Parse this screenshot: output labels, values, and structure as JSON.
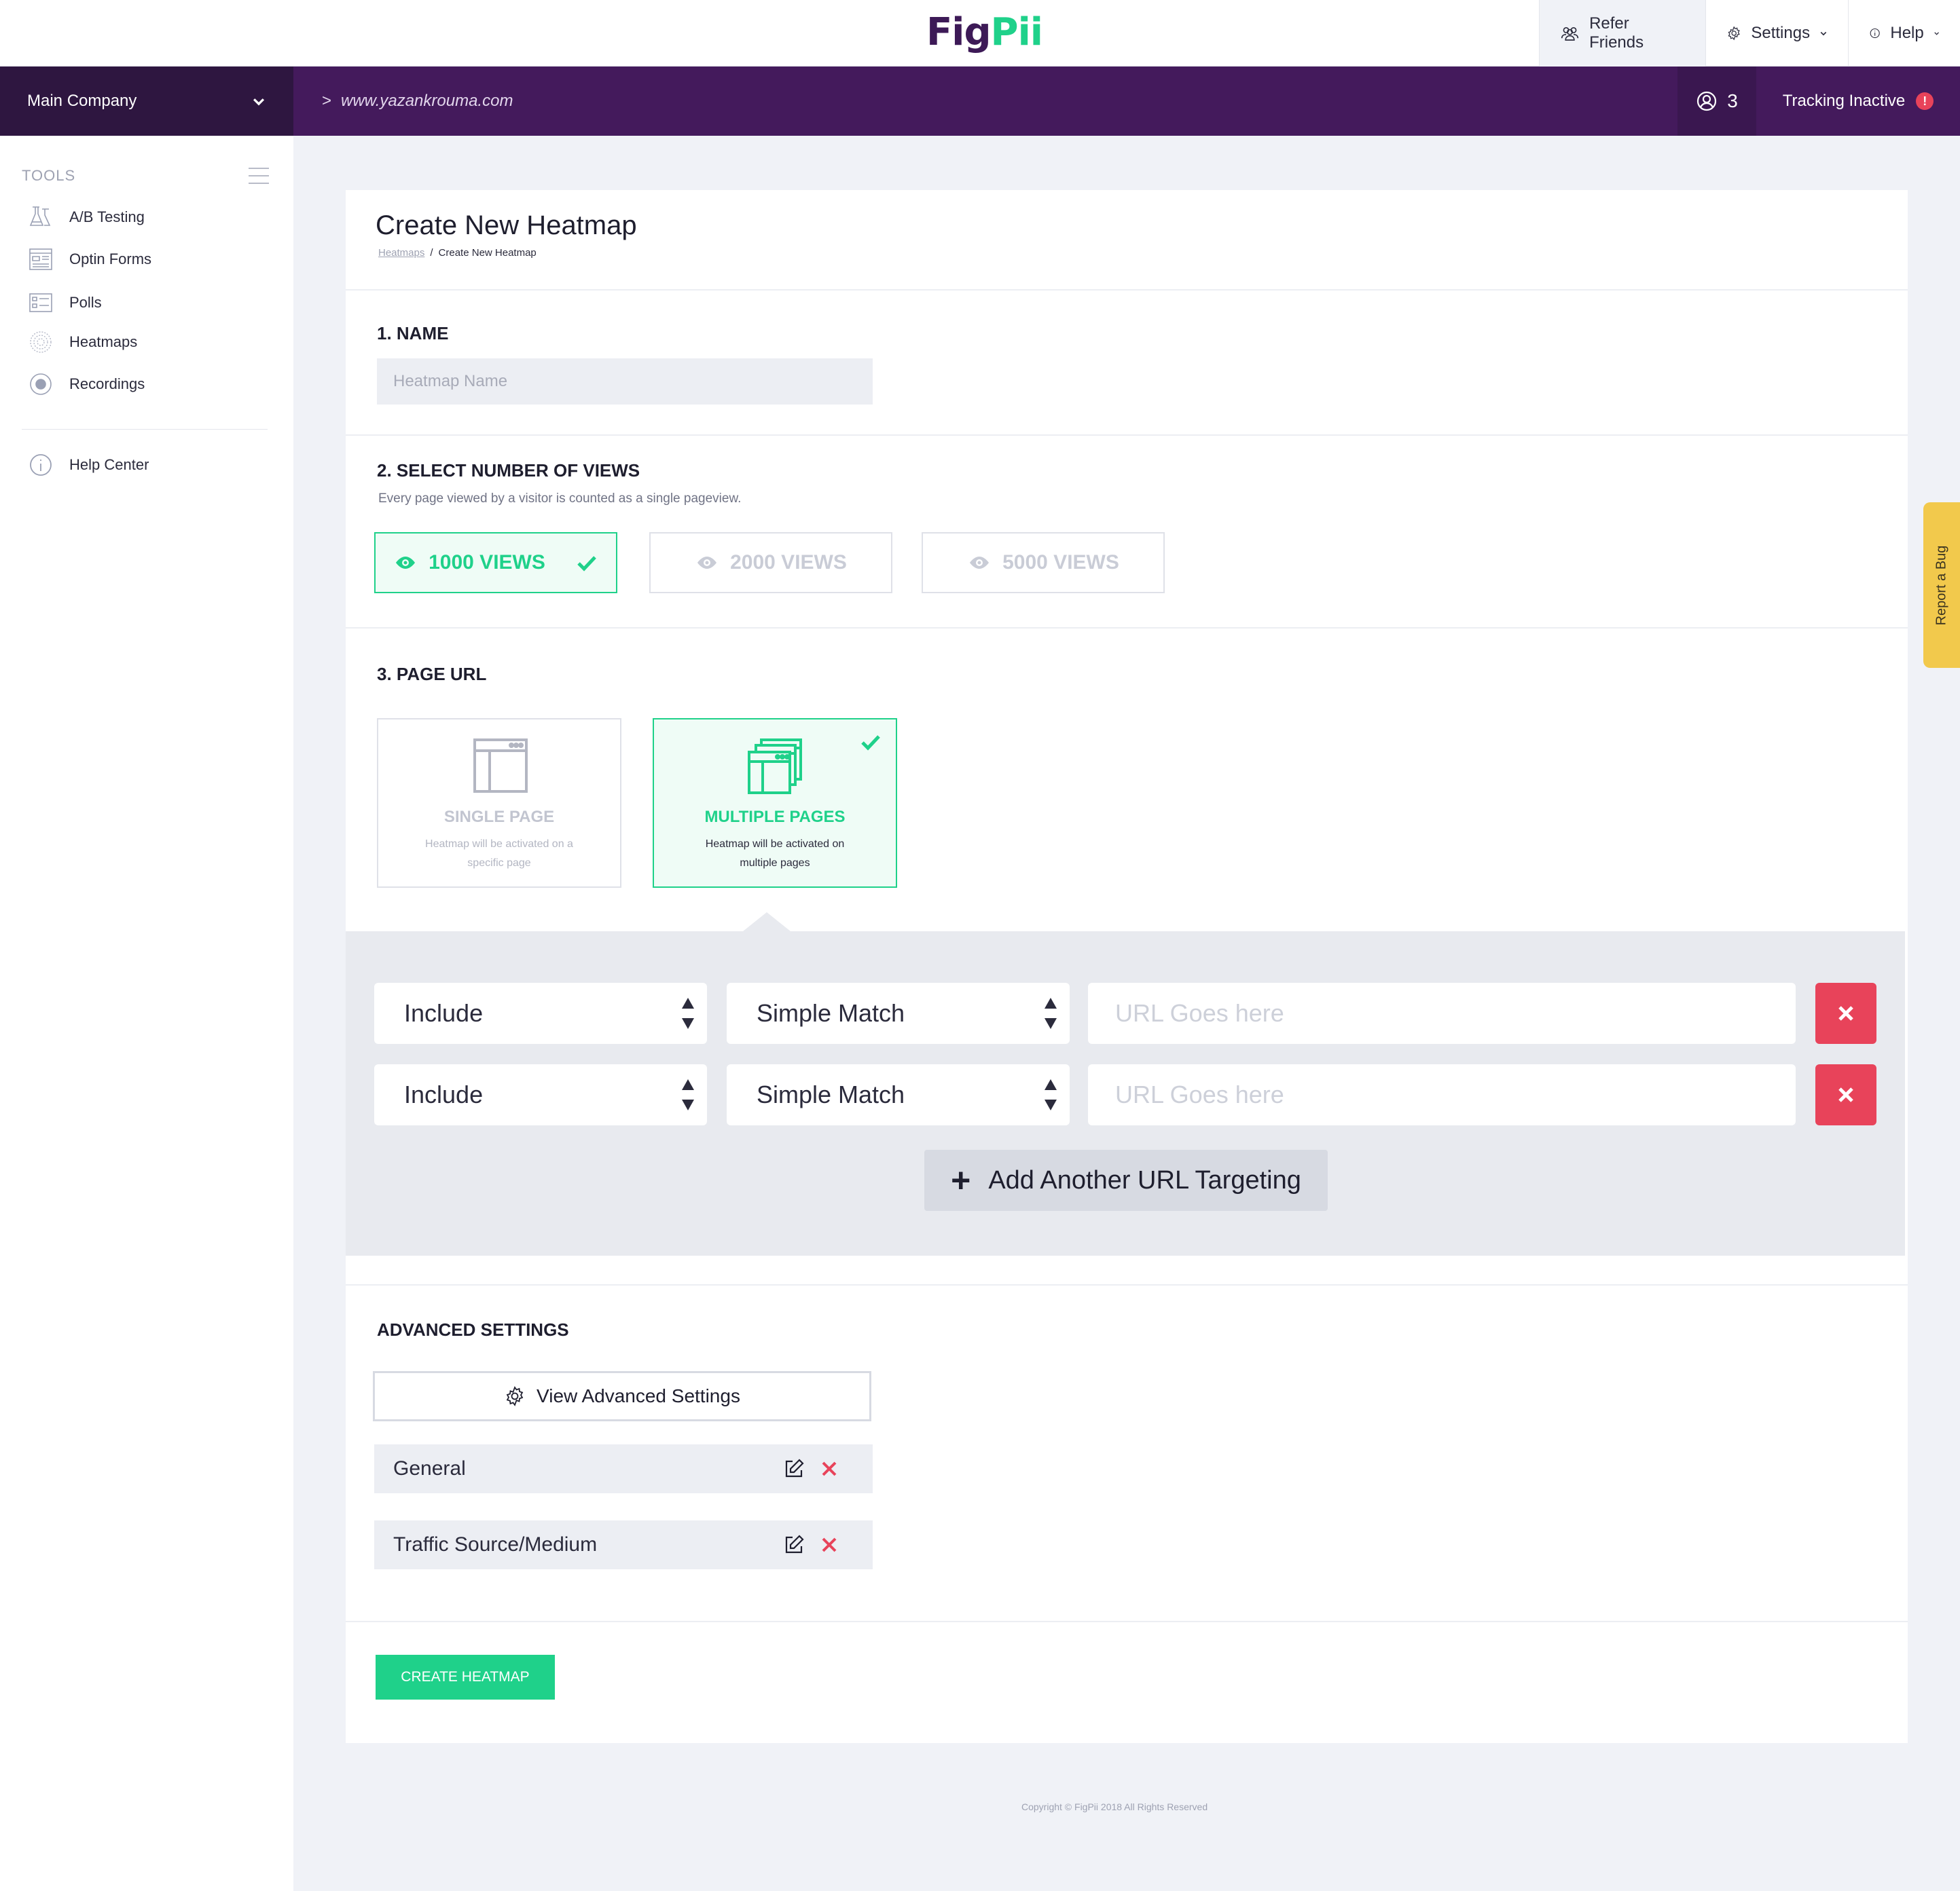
{
  "topbar": {
    "logo_part1": "Fig",
    "logo_part2": "Pii",
    "refer_label": "Refer Friends",
    "settings_label": "Settings",
    "help_label": "Help"
  },
  "subbar": {
    "company": "Main Company",
    "url_prefix": ">",
    "site_url": "www.yazankrouma.com",
    "user_count": "3",
    "tracking_status": "Tracking Inactive",
    "tracking_info_glyph": "!"
  },
  "sidebar": {
    "heading": "TOOLS",
    "items": [
      {
        "label": "A/B Testing",
        "icon": "flask-icon"
      },
      {
        "label": "Optin Forms",
        "icon": "form-icon"
      },
      {
        "label": "Polls",
        "icon": "poll-icon"
      },
      {
        "label": "Heatmaps",
        "icon": "heatmap-icon"
      },
      {
        "label": "Recordings",
        "icon": "record-icon"
      }
    ],
    "help_center": "Help Center"
  },
  "page": {
    "title": "Create New Heatmap",
    "breadcrumb_parent": "Heatmaps",
    "breadcrumb_sep": "/",
    "breadcrumb_current": "Create New Heatmap"
  },
  "name_section": {
    "label": "1. NAME",
    "placeholder": "Heatmap Name",
    "value": ""
  },
  "views_section": {
    "label": "2. SELECT NUMBER OF VIEWS",
    "subtitle": "Every page viewed by a visitor is counted as a single pageview.",
    "options": [
      "1000 VIEWS",
      "2000 VIEWS",
      "5000 VIEWS"
    ],
    "selected": "1000 VIEWS"
  },
  "url_section": {
    "label": "3. PAGE URL",
    "single": {
      "title": "SINGLE PAGE",
      "desc": "Heatmap will be activated on a specific page"
    },
    "multiple": {
      "title": "MULTIPLE PAGES",
      "desc": "Heatmap will be activated on multiple pages"
    },
    "selected": "MULTIPLE PAGES",
    "rules": [
      {
        "mode": "Include",
        "match": "Simple Match",
        "placeholder": "URL Goes here",
        "value": ""
      },
      {
        "mode": "Include",
        "match": "Simple Match",
        "placeholder": "URL Goes here",
        "value": ""
      }
    ],
    "add_label": "Add Another URL Targeting",
    "add_glyph": "+"
  },
  "advanced": {
    "label": "ADVANCED SETTINGS",
    "view_label": "View Advanced Settings",
    "rows": [
      "General",
      "Traffic Source/Medium"
    ]
  },
  "create_label": "CREATE HEATMAP",
  "copyright": "Copyright © FigPii 2018 All Rights Reserved",
  "report_bug": "Report a Bug",
  "colors": {
    "brand_purple": "#441a5c",
    "accent_green": "#1fd18a",
    "danger_red": "#e8435a",
    "bug_yellow": "#f2c94c"
  }
}
